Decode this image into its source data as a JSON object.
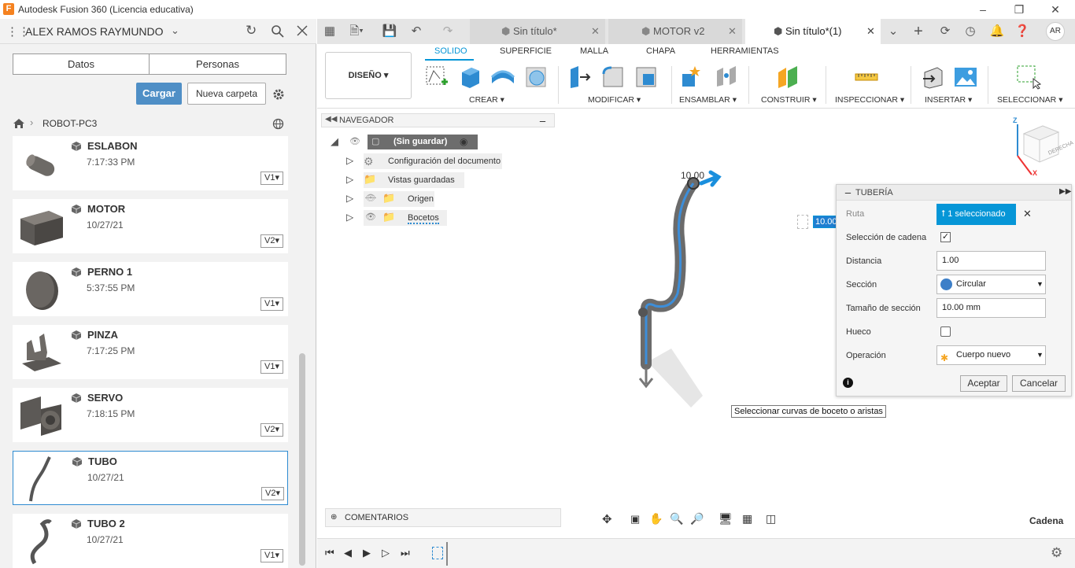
{
  "window": {
    "title": "Autodesk Fusion 360 (Licencia educativa)",
    "logo_letter": "F"
  },
  "data_panel": {
    "user": "ALEX RAMOS RAYMUNDO",
    "tabs": [
      "Datos",
      "Personas"
    ],
    "upload_label": "Cargar",
    "new_folder_label": "Nueva carpeta",
    "breadcrumb": "ROBOT-PC3",
    "files": [
      {
        "name": "ESLABON",
        "time": "7:17:33 PM",
        "version": "V1"
      },
      {
        "name": "MOTOR",
        "time": "10/27/21",
        "version": "V2"
      },
      {
        "name": "PERNO 1",
        "time": "5:37:55 PM",
        "version": "V1"
      },
      {
        "name": "PINZA",
        "time": "7:17:25 PM",
        "version": "V1"
      },
      {
        "name": "SERVO",
        "time": "7:18:15 PM",
        "version": "V2"
      },
      {
        "name": "TUBO",
        "time": "10/27/21",
        "version": "V2"
      },
      {
        "name": "TUBO 2",
        "time": "10/27/21",
        "version": "V1"
      }
    ]
  },
  "doc_tabs": [
    {
      "label": "Sin título*"
    },
    {
      "label": "MOTOR v2"
    },
    {
      "label": "Sin título*(1)"
    }
  ],
  "toolbar": {
    "workspace": "DISEÑO",
    "tabs": [
      "SOLIDO",
      "SUPERFICIE",
      "MALLA",
      "CHAPA",
      "HERRAMIENTAS"
    ],
    "groups": [
      "CREAR",
      "MODIFICAR",
      "ENSAMBLAR",
      "CONSTRUIR",
      "INSPECCIONAR",
      "INSERTAR",
      "SELECCIONAR"
    ]
  },
  "navigator": {
    "title": "NAVEGADOR",
    "root": "(Sin guardar)",
    "items": [
      "Configuración del documento",
      "Vistas guardadas",
      "Origen",
      "Bocetos"
    ]
  },
  "viewport": {
    "dim_label": "10.00",
    "input_value": "10.00 mm",
    "tooltip": "Seleccionar curvas de boceto o aristas",
    "viewcube_label": "DERECHA",
    "axis_z": "Z",
    "axis_x": "X"
  },
  "dialog": {
    "title": "TUBERÍA",
    "ruta_label": "Ruta",
    "ruta_value": "1 seleccionado",
    "chain_label": "Selección de cadena",
    "distance_label": "Distancia",
    "distance_value": "1.00",
    "section_label": "Sección",
    "section_value": "Circular",
    "section_size_label": "Tamaño de sección",
    "section_size_value": "10.00 mm",
    "hollow_label": "Hueco",
    "operation_label": "Operación",
    "operation_value": "Cuerpo nuevo",
    "ok": "Aceptar",
    "cancel": "Cancelar"
  },
  "bottom": {
    "comments": "COMENTARIOS",
    "status": "Cadena"
  },
  "colors": {
    "accent": "#0696d7",
    "button_blue": "#4f8fc6",
    "selection_blue": "#2e8bd1"
  }
}
